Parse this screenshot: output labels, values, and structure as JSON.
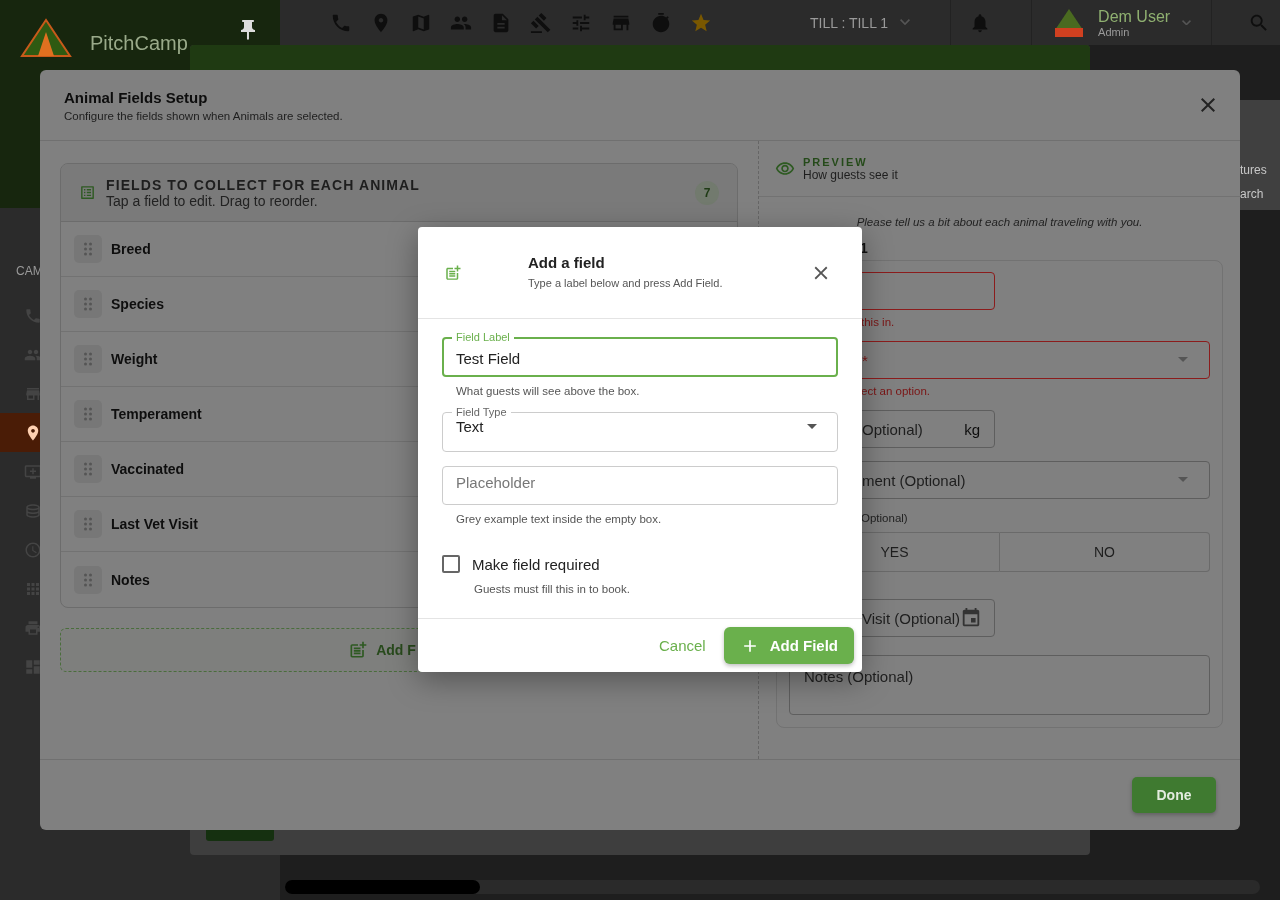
{
  "app_bar": {
    "brand": "PitchCamp",
    "till_selector": "TILL : TILL 1",
    "user": {
      "name": "Dem User",
      "role": "Admin"
    }
  },
  "sidebar": {
    "section_label": "CAM",
    "items": [
      {
        "selected": false
      },
      {
        "selected": false
      },
      {
        "selected": false
      },
      {
        "selected": true
      },
      {
        "selected": false
      },
      {
        "selected": false
      },
      {
        "selected": false
      },
      {
        "selected": false
      },
      {
        "selected": false
      },
      {
        "selected": false
      }
    ]
  },
  "side_panel": {
    "texts": [
      "tures",
      "arch"
    ]
  },
  "setup_dialog": {
    "title": "Animal Fields Setup",
    "subtitle": "Configure the fields shown when Animals are selected.",
    "fields_panel": {
      "heading": "FIELDS TO COLLECT FOR EACH ANIMAL",
      "hint": "Tap a field to edit. Drag to reorder.",
      "count": "7",
      "fields": [
        "Breed",
        "Species",
        "Weight",
        "Temperament",
        "Vaccinated",
        "Last Vet Visit",
        "Notes"
      ],
      "add_button": "Add F"
    },
    "preview": {
      "heading": "PREVIEW",
      "subheading": "How guests see it",
      "intro": "Please tell us a bit about each animal traveling with you.",
      "animal_number": "1",
      "fields": [
        {
          "kind": "text",
          "error": true,
          "helper": "this in."
        },
        {
          "kind": "select",
          "error": true,
          "label": "*",
          "helper": "ect an option."
        },
        {
          "kind": "unit",
          "error": false,
          "label": "Optional)",
          "unit": "kg"
        },
        {
          "kind": "select",
          "error": false,
          "label": "ment (Optional)"
        },
        {
          "kind": "toggle",
          "label": "Optional)",
          "options": [
            {
              "label": "YES",
              "selected": false
            },
            {
              "label": "NO",
              "selected": false
            }
          ]
        },
        {
          "kind": "date",
          "error": false,
          "label": "Visit (Optional)"
        },
        {
          "kind": "textarea",
          "error": false,
          "label": "Notes (Optional)"
        }
      ]
    },
    "done_button": "Done"
  },
  "add_field_dialog": {
    "title": "Add a field",
    "subtitle": "Type a label below and press Add Field.",
    "label_field": {
      "label": "Field Label",
      "value": "Test Field",
      "focused": true,
      "helper": "What guests will see above the box."
    },
    "type_field": {
      "label": "Field Type",
      "value": "Text"
    },
    "placeholder_field": {
      "placeholder": "Placeholder",
      "helper": "Grey example text inside the empty box."
    },
    "required": {
      "label": "Make field required",
      "checked": false,
      "helper": "Guests must fill this in to book."
    },
    "cancel_button": "Cancel",
    "add_button": "Add Field"
  }
}
